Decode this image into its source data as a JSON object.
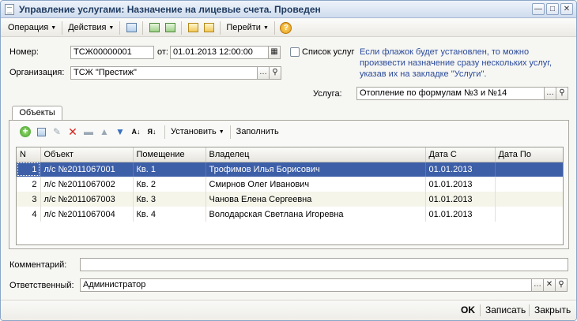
{
  "window": {
    "title": "Управление услугами: Назначение на лицевые счета. Проведен",
    "buttons": {
      "minimize": "—",
      "maximize": "□",
      "close": "✕"
    }
  },
  "toolbar": {
    "operation": "Операция",
    "actions": "Действия",
    "goto": "Перейти",
    "help": "?"
  },
  "form": {
    "number_label": "Номер:",
    "number_value": "ТСЖ00000001",
    "from_label": "от:",
    "date_value": "01.01.2013 12:00:00",
    "services_list_label": "Список услуг",
    "hint": "Если флажок будет установлен, то можно произвести назначение сразу нескольких услуг, указав их на закладке \"Услуги\".",
    "org_label": "Организация:",
    "org_value": "ТСЖ \"Престиж\"",
    "service_label": "Услуга:",
    "service_value": "Отопление по формулам №3 и №14",
    "comment_label": "Комментарий:",
    "comment_value": "",
    "responsible_label": "Ответственный:",
    "responsible_value": "Администратор"
  },
  "tabs": [
    {
      "label": "Объекты"
    }
  ],
  "objects_toolbar": {
    "set": "Установить",
    "fill": "Заполнить"
  },
  "table": {
    "columns": [
      "N",
      "Объект",
      "Помещение",
      "Владелец",
      "Дата С",
      "Дата По"
    ],
    "rows": [
      {
        "n": "1",
        "object": "л/с №2011067001",
        "room": "Кв. 1",
        "owner": "Трофимов Илья Борисович",
        "date_from": "01.01.2013",
        "date_to": ""
      },
      {
        "n": "2",
        "object": "л/с №2011067002",
        "room": "Кв. 2",
        "owner": "Смирнов Олег Иванович",
        "date_from": "01.01.2013",
        "date_to": ""
      },
      {
        "n": "3",
        "object": "л/с №2011067003",
        "room": "Кв. 3",
        "owner": "Чанова Елена Сергеевна",
        "date_from": "01.01.2013",
        "date_to": ""
      },
      {
        "n": "4",
        "object": "л/с №2011067004",
        "room": "Кв. 4",
        "owner": "Володарская Светлана Игоревна",
        "date_from": "01.01.2013",
        "date_to": ""
      }
    ]
  },
  "footer": {
    "ok": "OK",
    "save": "Записать",
    "close": "Закрыть"
  }
}
